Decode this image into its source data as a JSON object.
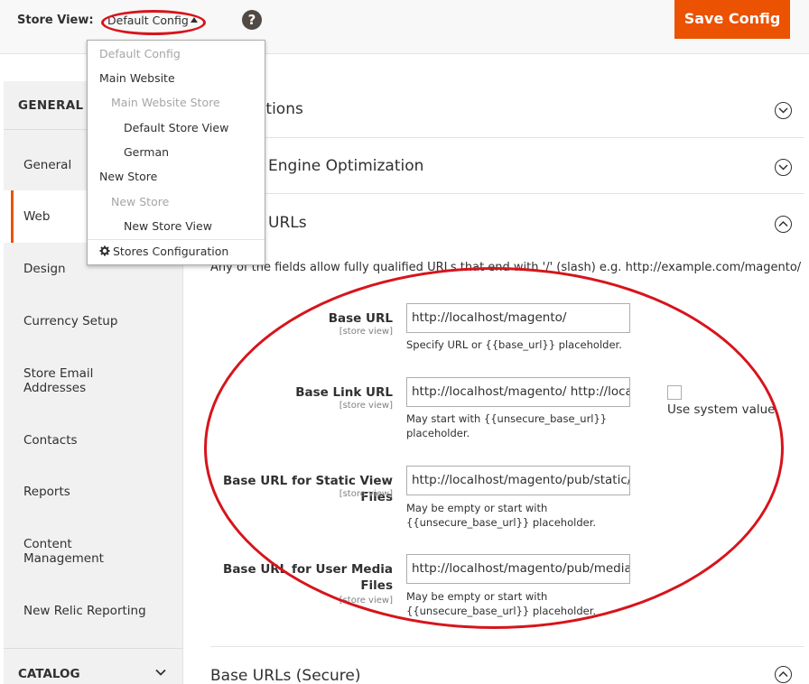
{
  "header": {
    "store_view_label": "Store View:",
    "store_view_selected": "Default Config",
    "help_icon": "question-icon",
    "save_label": "Save Config"
  },
  "scope_dropdown": {
    "items": [
      {
        "label": "Default Config",
        "state": "disabled"
      },
      {
        "label": "Main Website",
        "state": "enabled"
      },
      {
        "label": "Main Website Store",
        "state": "disabled"
      },
      {
        "label": "Default Store View",
        "state": "enabled"
      },
      {
        "label": "German",
        "state": "enabled"
      },
      {
        "label": "New Store",
        "state": "enabled"
      },
      {
        "label": "New Store",
        "state": "disabled"
      },
      {
        "label": "New Store View",
        "state": "enabled"
      }
    ],
    "footer_label": "Stores Configuration",
    "footer_icon": "gear-icon"
  },
  "sidebar": {
    "group_title": "GENERAL",
    "items": [
      {
        "label": "General"
      },
      {
        "label": "Web",
        "active": true
      },
      {
        "label": "Design"
      },
      {
        "label": "Currency Setup"
      },
      {
        "label": "Store Email\nAddresses"
      },
      {
        "label": "Contacts"
      },
      {
        "label": "Reports"
      },
      {
        "label": "Content\nManagement"
      },
      {
        "label": "New Relic Reporting"
      }
    ],
    "catalog_title": "CATALOG"
  },
  "sections": {
    "s1": "ations",
    "s2": "Engine Optimization",
    "s3": "URLs",
    "s4": "Base URLs (Secure)"
  },
  "base_urls": {
    "hint": "Any of the fields allow fully qualified URLs that end with '/' (slash) e.g. http://example.com/magento/",
    "fields": [
      {
        "label": "Base URL",
        "scope": "[store view]",
        "value": "http://localhost/magento/",
        "note": "Specify URL or {{base_url}} placeholder."
      },
      {
        "label": "Base Link URL",
        "scope": "[store view]",
        "value": "http://localhost/magento/ http://loca",
        "note": "May start with {{unsecure_base_url}}\nplaceholder."
      },
      {
        "label": "Base URL for Static View Files",
        "scope": "[store view]",
        "value": "http://localhost/magento/pub/static/",
        "note": "May be empty or start with\n{{unsecure_base_url}} placeholder."
      },
      {
        "label": "Base URL for User Media\nFiles",
        "scope": "[store view]",
        "value": "http://localhost/magento/pub/media/",
        "note": "May be empty or start with\n{{unsecure_base_url}} placeholder."
      }
    ],
    "use_system_value": "Use system value"
  },
  "colors": {
    "accent": "#eb5202",
    "annotation_red": "#d7141b"
  }
}
